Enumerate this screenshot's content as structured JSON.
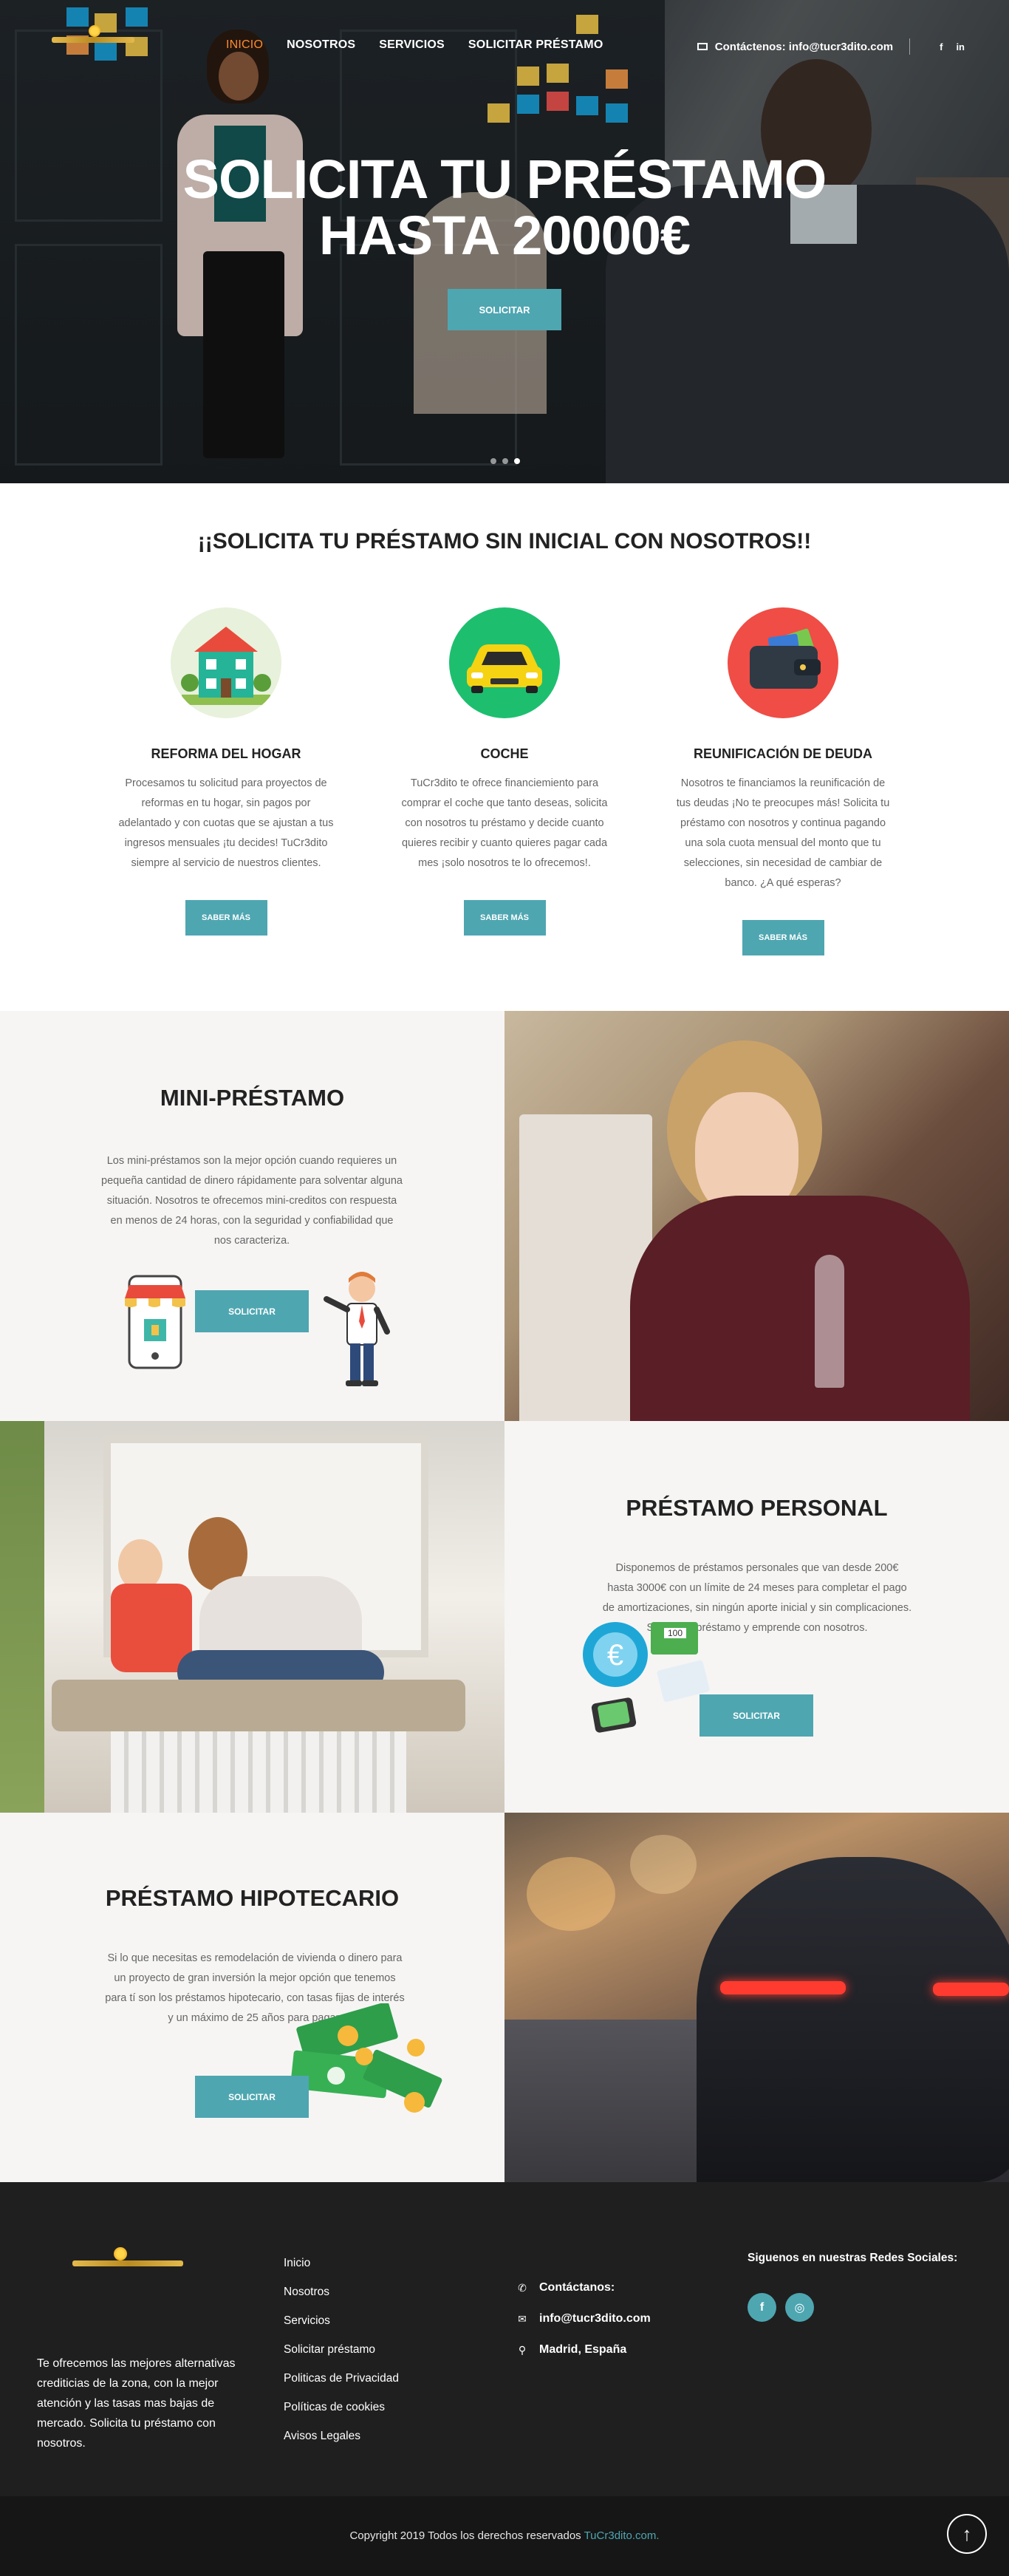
{
  "nav": {
    "menu": [
      "INICIO",
      "NOSOTROS",
      "SERVICIOS",
      "SOLICITAR PRÉSTAMO"
    ],
    "contact": "Contáctenos: info@tucr3dito.com",
    "social": [
      "f",
      "in"
    ]
  },
  "hero": {
    "title_line1": "SOLICITA TU PRÉSTAMO",
    "title_line2": "HASTA 20000€",
    "button": "SOLICITAR"
  },
  "services": {
    "title": "¡¡SOLICITA TU PRÉSTAMO SIN INICIAL CON NOSOTROS!!",
    "cards": [
      {
        "title": "REFORMA DEL HOGAR",
        "text": "Procesamos tu solicitud para proyectos de reformas en tu hogar, sin pagos por adelantado y con cuotas que se ajustan a tus ingresos mensuales ¡tu decides! TuCr3dito siempre al servicio de nuestros clientes.",
        "button": "SABER MÁS",
        "icon": "house-icon",
        "color": "#e5f0d7"
      },
      {
        "title": "COCHE",
        "text": "TuCr3dito te ofrece financiemiento para comprar el coche que tanto deseas, solicita con nosotros tu préstamo y decide cuanto quieres recibir y cuanto quieres pagar cada mes ¡solo nosotros te lo ofrecemos!.",
        "button": "SABER MÁS",
        "icon": "car-icon",
        "color": "#1dbf6f"
      },
      {
        "title": "REUNIFICACIÓN DE DEUDA",
        "text": "Nosotros te financiamos la reunificación de tus deudas ¡No te preocupes más! Solicita tu préstamo con nosotros y continua pagando una sola cuota mensual del monto que tu selecciones, sin necesidad de cambiar de banco. ¿A qué esperas?",
        "button": "SABER MÁS",
        "icon": "wallet-icon",
        "color": "#ef4d45"
      }
    ]
  },
  "mini": {
    "title": "MINI-PRÉSTAMO",
    "text": "Los mini-préstamos son la mejor opción cuando requieres un pequeña cantidad de dinero rápidamente para solventar alguna situación. Nosotros te ofrecemos mini-creditos con respuesta en menos de 24 horas, con la seguridad y confiabilidad que nos caracteriza.",
    "button": "SOLICITAR"
  },
  "personal": {
    "title": "PRÉSTAMO PERSONAL",
    "text": "Disponemos de préstamos personales que van desde 200€ hasta 3000€ con un límite de 24 meses para completar el pago de amortizaciones, sin ningún aporte inicial y sin complicaciones. Solicita tu préstamo y emprende con nosotros.",
    "button": "SOLICITAR",
    "bill": "100"
  },
  "hipotecario": {
    "title": "PRÉSTAMO HIPOTECARIO",
    "text": "Si lo que necesitas es remodelación de vivienda o dinero para un proyecto de gran inversión la mejor opción que tenemos para tí son los préstamos hipotecario, con tasas fijas de interés y un máximo de 25 años para pagar.",
    "button": "SOLICITAR"
  },
  "footer": {
    "about": "Te ofrecemos las mejores alternativas crediticias de la zona, con la mejor atención y las tasas mas bajas de mercado. Solicita tu préstamo con nosotros.",
    "links": [
      "Inicio",
      "Nosotros",
      "Servicios",
      "Solicitar préstamo",
      "Politicas de Privacidad",
      "Políticas de cookies",
      "Avisos Legales"
    ],
    "contact_title": "Contáctanos:",
    "email": "info@tucr3dito.com",
    "location": "Madrid, España",
    "social_title": "Siguenos en nuestras Redes Sociales:",
    "social": [
      "f",
      "◎"
    ]
  },
  "copyright": {
    "text": "Copyright 2019 Todos los derechos reservados ",
    "brand": "TuCr3dito.com."
  },
  "colors": {
    "accent": "#4ea6b1",
    "dark": "#1f1f1f",
    "active": "#ff8b2c"
  }
}
